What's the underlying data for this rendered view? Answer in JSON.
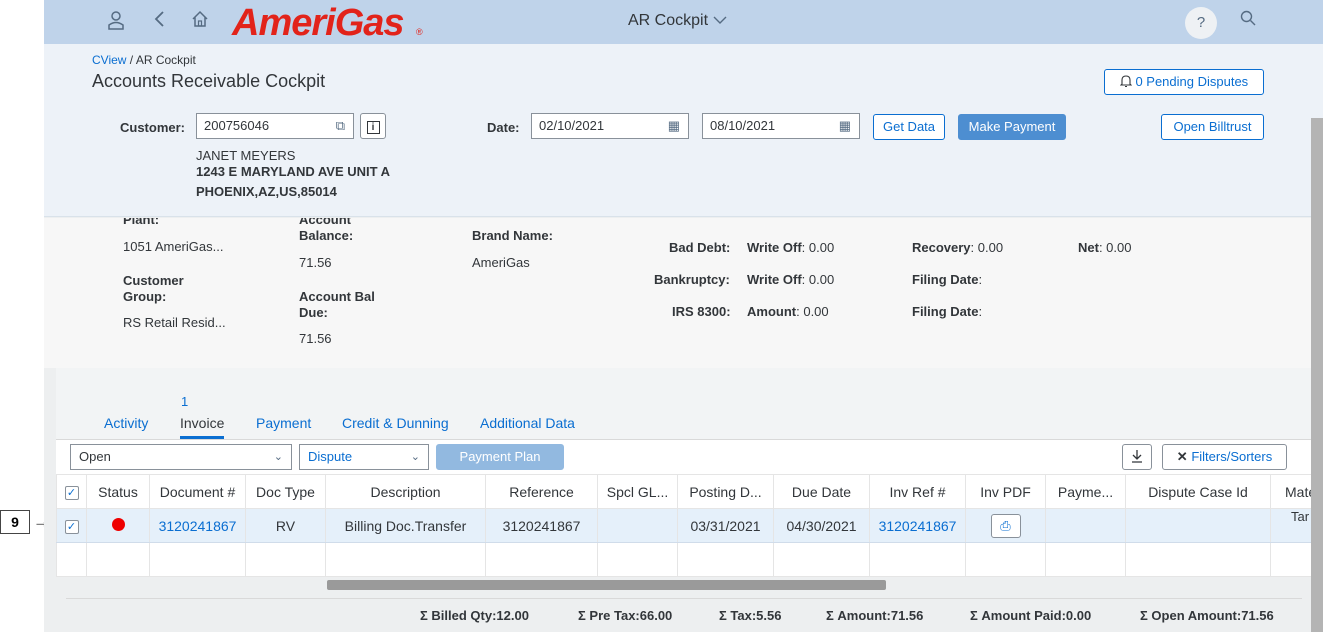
{
  "shell": {
    "logo_text": "AmeriGas",
    "logo_mark": "®",
    "app_title": "AR Cockpit",
    "help_label": "?",
    "icons": [
      "user-icon",
      "back-icon",
      "home-icon",
      "help-icon",
      "search-icon"
    ],
    "brand_color": "#e2231a",
    "bar_color": "#bfd3ea"
  },
  "header": {
    "breadcrumb_link": "CView",
    "breadcrumb_sep": " / ",
    "breadcrumb_current": "AR Cockpit",
    "title": "Accounts Receivable Cockpit",
    "pending_disputes": "0 Pending Disputes",
    "customer_label": "Customer:",
    "customer_value": "200756046",
    "date_label": "Date:",
    "date_from": "02/10/2021",
    "date_to": "08/10/2021",
    "get_data": "Get Data",
    "make_payment": "Make Payment",
    "open_billtrust": "Open Billtrust",
    "name": "JANET MEYERS",
    "address1": "1243 E MARYLAND AVE UNIT A",
    "address2": "PHOENIX,AZ,US,85014"
  },
  "facts": {
    "plant_label": "Plant:",
    "plant_value": "1051 AmeriGas...",
    "customer_group_label_1": "Customer",
    "customer_group_label_2": "Group:",
    "customer_group_value": "RS Retail Resid...",
    "account_label": "Account",
    "balance_label": "Balance:",
    "balance_value": "71.56",
    "bal_due_label_1": "Account Bal",
    "bal_due_label_2": "Due:",
    "bal_due_value": "71.56",
    "brand_label": "Brand Name:",
    "brand_value": "AmeriGas",
    "bad_debt": "Bad Debt:",
    "bankruptcy": "Bankruptcy:",
    "irs": "IRS 8300:",
    "write_off_key": "Write Off",
    "write_off_1": ": 0.00",
    "write_off_2": ": 0.00",
    "amount_key": "Amount",
    "amount_val": ": 0.00",
    "recovery_key": "Recovery",
    "recovery_val": ": 0.00",
    "net_key": "Net",
    "net_val": ": 0.00",
    "filing_key": "Filing Date",
    "filing_val": ":"
  },
  "tabs": {
    "count": "1",
    "items": [
      "Activity",
      "Invoice",
      "Payment",
      "Credit & Dunning",
      "Additional Data"
    ]
  },
  "toolbar": {
    "status_filter": "Open",
    "dispute_filter": "Dispute",
    "payment_plan": "Payment Plan",
    "filters_sorters": "Filters/Sorters"
  },
  "table": {
    "columns": [
      "Status",
      "Document #",
      "Doc Type",
      "Description",
      "Reference",
      "Spcl GL...",
      "Posting D...",
      "Due Date",
      "Inv Ref #",
      "Inv PDF",
      "Payme...",
      "Dispute Case Id",
      "Mate"
    ],
    "row": {
      "document": "3120241867",
      "doc_type": "RV",
      "description": "Billing Doc.Transfer",
      "reference": "3120241867",
      "spcl_gl": "",
      "posting_date": "03/31/2021",
      "due_date": "04/30/2021",
      "inv_ref": "3120241867",
      "payment": "",
      "dispute_case": "",
      "material": "Tar"
    }
  },
  "totals": {
    "billed_qty": "Σ Billed Qty:12.00",
    "pre_tax": "Σ Pre Tax:66.00",
    "tax": "Σ Tax:5.56",
    "amount": "Σ Amount:71.56",
    "amount_paid": "Σ Amount Paid:0.00",
    "open_amount": "Σ Open Amount:71.56"
  },
  "annotation": {
    "marker": "9",
    "arrow": "→"
  }
}
